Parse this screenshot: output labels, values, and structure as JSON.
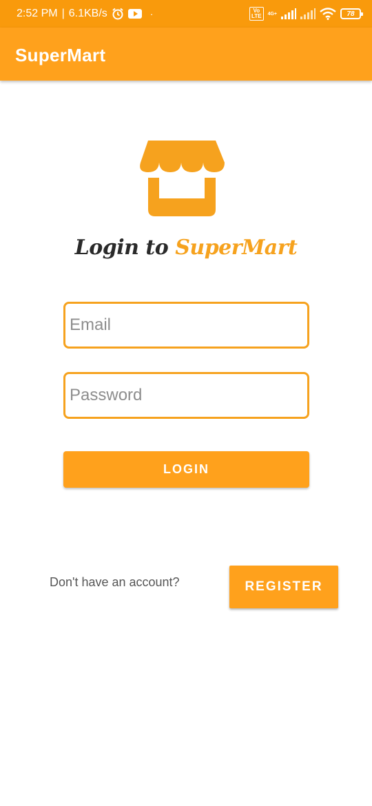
{
  "status_bar": {
    "time": "2:52 PM",
    "speed": "6.1KB/s",
    "dot": "·",
    "volte": "Vo\nLTE",
    "network_type": "4G+",
    "battery": "78"
  },
  "app_bar": {
    "title": "SuperMart"
  },
  "heading": {
    "prefix": "Login to",
    "brand": "SuperMart"
  },
  "form": {
    "email_placeholder": "Email",
    "email_value": "",
    "password_placeholder": "Password",
    "password_value": "",
    "login_label": "LOGIN"
  },
  "footer": {
    "prompt": "Don't have an account?",
    "register_label": "REGISTER"
  },
  "colors": {
    "status_bar": "#F99A0C",
    "app_bar": "#FFA11C",
    "accent": "#F6A21E",
    "text_dark": "#2a2a2a"
  }
}
